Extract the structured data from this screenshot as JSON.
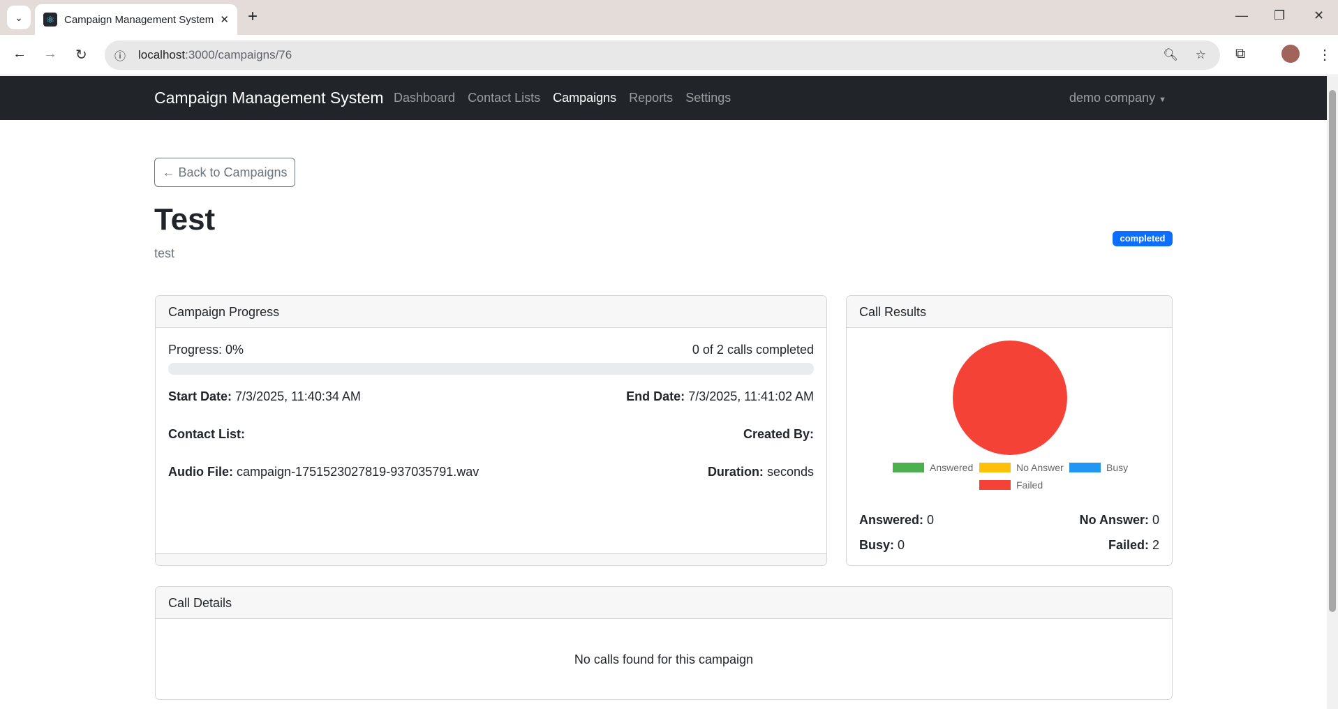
{
  "browser": {
    "tab_title": "Campaign Management System",
    "url_host": "localhost",
    "url_path": ":3000/campaigns/76"
  },
  "navbar": {
    "brand": "Campaign Management System",
    "links": [
      "Dashboard",
      "Contact Lists",
      "Campaigns",
      "Reports",
      "Settings"
    ],
    "active": "Campaigns",
    "company": "demo company"
  },
  "page": {
    "back_label": "← Back to Campaigns",
    "title": "Test",
    "description": "test",
    "status": "completed"
  },
  "progress_card": {
    "title": "Campaign Progress",
    "progress_label": "Progress: 0%",
    "progress_percent": 0,
    "calls_completed": "0 of 2 calls completed",
    "start_label": "Start Date:",
    "start_value": "7/3/2025, 11:40:34 AM",
    "end_label": "End Date:",
    "end_value": "7/3/2025, 11:41:02 AM",
    "contact_list_label": "Contact List:",
    "created_by_label": "Created By:",
    "audio_label": "Audio File:",
    "audio_value": "campaign-1751523027819-937035791.wav",
    "duration_label": "Duration:",
    "duration_value": "seconds"
  },
  "results_card": {
    "title": "Call Results",
    "answered_label": "Answered:",
    "answered": "0",
    "no_answer_label": "No Answer:",
    "no_answer": "0",
    "busy_label": "Busy:",
    "busy": "0",
    "failed_label": "Failed:",
    "failed": "2"
  },
  "chart_data": {
    "type": "pie",
    "categories": [
      "Answered",
      "No Answer",
      "Busy",
      "Failed"
    ],
    "values": [
      0,
      0,
      0,
      2
    ],
    "colors": [
      "#4caf50",
      "#ffc107",
      "#2196f3",
      "#f44336"
    ],
    "legend": "bottom"
  },
  "details_card": {
    "title": "Call Details",
    "empty": "No calls found for this campaign"
  }
}
